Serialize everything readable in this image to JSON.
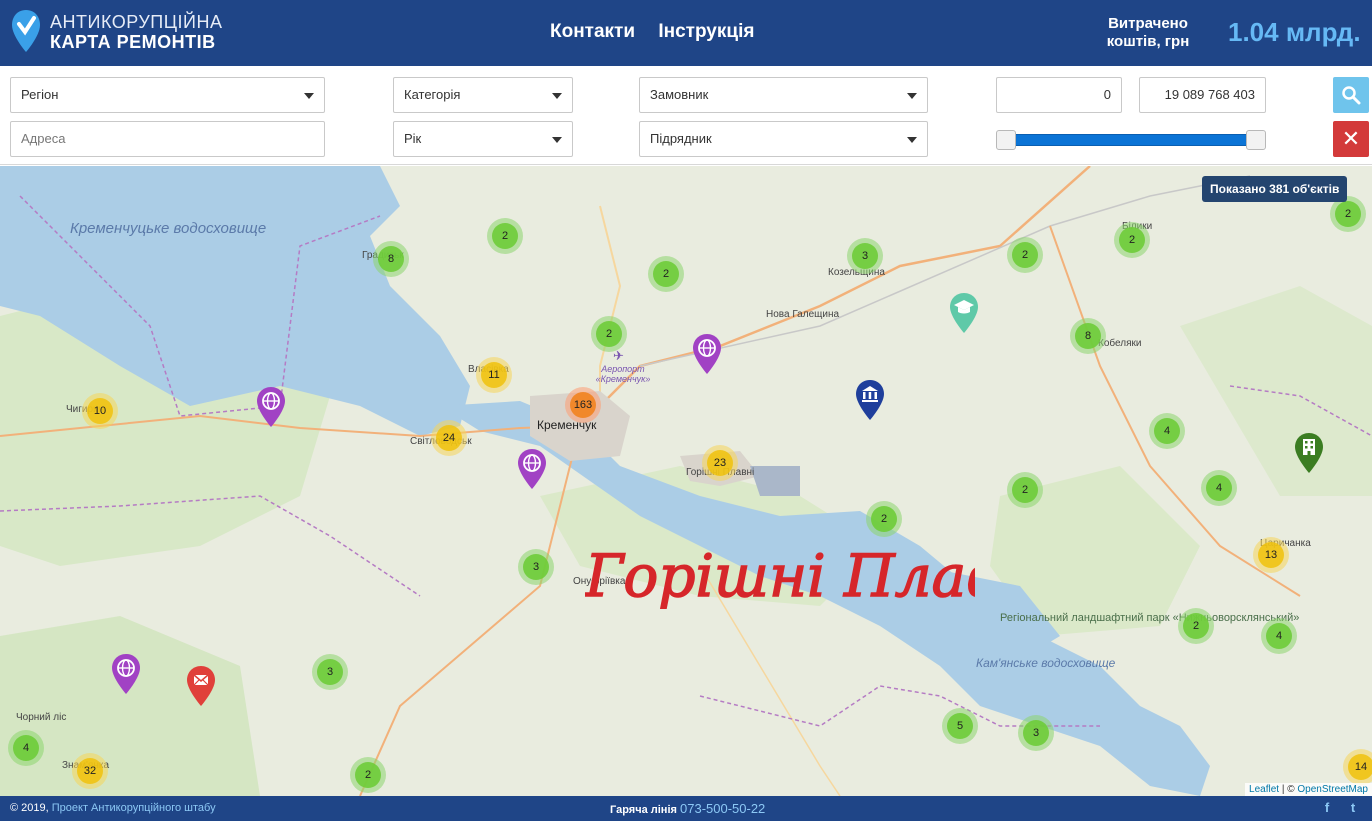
{
  "header": {
    "logo_line1": "АНТИКОРУПЦІЙНА",
    "logo_line2": "КАРТА РЕМОНТІВ",
    "nav": [
      "Контакти",
      "Інструкція"
    ],
    "spent_label": "Витрачено коштів, грн",
    "spent_value": "1.04 млрд."
  },
  "filters": {
    "region": "Регіон",
    "category": "Категорія",
    "customer": "Замовник",
    "address_placeholder": "Адреса",
    "year": "Рік",
    "contractor": "Підрядник",
    "amount_min": "0",
    "amount_max": "19 089 768 403",
    "range_fraction": [
      0,
      1
    ]
  },
  "map": {
    "shown_badge": "Показано 381 об'єктів",
    "labels": {
      "kremenchuk_reservoir": "Кременчуцьке водосховище",
      "kamianske_reservoir": "Кам'янське водосховище",
      "park": "Регіональний ландшафтний парк «Нижньоворсклянський»",
      "kremenchuk": "Кременчук",
      "kozelshchyna": "Козельщина",
      "nova_halechchyna": "Нова Галещина",
      "airport": "Аеропорт «Кременчук»",
      "horishni_plavni": "Горішні Плавні",
      "onufriivka": "Онуфріївка",
      "svitlovodsk": "Світловодськ",
      "chyhyryn": "Чигирин",
      "chornyi_lis": "Чорний ліс",
      "hradyzk": "Градизьк",
      "vlasivka": "Власівка",
      "znamianka": "Знам'янка",
      "kobeliaky": "Кобеляки",
      "biliky": "Білики",
      "tsarychanka": "Царичанка"
    },
    "clusters": [
      "8",
      "2",
      "2",
      "3",
      "2",
      "2",
      "8",
      "2",
      "11",
      "2",
      "163",
      "10",
      "24",
      "23",
      "4",
      "4",
      "2",
      "2",
      "13",
      "3",
      "2",
      "4",
      "3",
      "4",
      "32",
      "2",
      "5",
      "3",
      "14"
    ],
    "pins": [
      "globe",
      "globe",
      "globe",
      "globe",
      "institution",
      "education",
      "building",
      "mail"
    ],
    "annotation": "Горішні Плавні !!!",
    "attribution_leaflet": "Leaflet",
    "attribution_osm": "OpenStreetMap"
  },
  "footer": {
    "copyright": "© 2019,",
    "project_link": "Проект Антикорупційного штабу",
    "hotline_label": "Гаряча лінія",
    "hotline_phone": "073-500-50-22"
  }
}
